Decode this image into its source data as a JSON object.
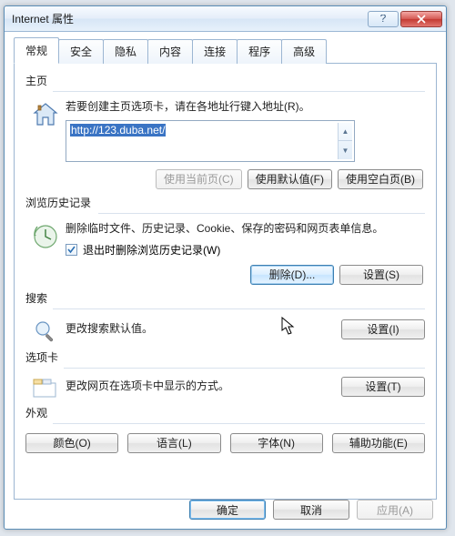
{
  "title": "Internet 属性",
  "tabs": [
    "常规",
    "安全",
    "隐私",
    "内容",
    "连接",
    "程序",
    "高级"
  ],
  "active_tab": 0,
  "homepage": {
    "label": "主页",
    "desc": "若要创建主页选项卡，请在各地址行键入地址(R)。",
    "url": "http://123.duba.net/",
    "use_current": "使用当前页(C)",
    "use_default": "使用默认值(F)",
    "use_blank": "使用空白页(B)"
  },
  "history": {
    "label": "浏览历史记录",
    "desc": "删除临时文件、历史记录、Cookie、保存的密码和网页表单信息。",
    "chk_label": "退出时删除浏览历史记录(W)",
    "chk_checked": true,
    "delete": "删除(D)...",
    "settings": "设置(S)"
  },
  "search": {
    "label": "搜索",
    "desc": "更改搜索默认值。",
    "settings": "设置(I)"
  },
  "tabs_group": {
    "label": "选项卡",
    "desc": "更改网页在选项卡中显示的方式。",
    "settings": "设置(T)"
  },
  "appearance": {
    "label": "外观",
    "colors": "颜色(O)",
    "languages": "语言(L)",
    "fonts": "字体(N)",
    "accessibility": "辅助功能(E)"
  },
  "dialog_buttons": {
    "ok": "确定",
    "cancel": "取消",
    "apply": "应用(A)"
  }
}
